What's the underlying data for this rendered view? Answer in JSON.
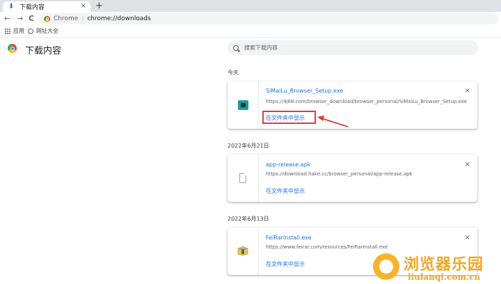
{
  "tab": {
    "title": "下载内容",
    "close": "×",
    "new_tab": "+"
  },
  "toolbar": {
    "back": "←",
    "forward": "→",
    "reload": "C",
    "omnibox_label": "Chrome",
    "omnibox_sep": "|",
    "url": "chrome://downloads"
  },
  "bookmarks": [
    {
      "label": "应用"
    },
    {
      "label": "网址大全"
    }
  ],
  "page": {
    "title": "下载内容",
    "search_placeholder": "搜索下载内容"
  },
  "groups": [
    {
      "date": "今天",
      "item": {
        "name": "SiMaiLu_Browser_Setup.exe",
        "url": "https://4j88.com/browser_download/browser_personal/SiMaiLu_Browser_Setup.exe",
        "action": "在文件夹中显示",
        "remove": "×",
        "icon": "exe-icon"
      }
    },
    {
      "date": "2022年6月21日",
      "item": {
        "name": "app-release.apk",
        "url": "https://download.hake.cc/browser_personal/app-release.apk",
        "action": "在文件夹中显示",
        "remove": "×",
        "icon": "file-icon"
      }
    },
    {
      "date": "2022年6月13日",
      "item": {
        "name": "FeiRarInstall.exe",
        "url": "https://www.feirar.com/resources/FeiRarInstall.exe",
        "action": "在文件夹中显示",
        "remove": "×",
        "icon": "rar-icon"
      }
    }
  ],
  "watermark": {
    "cn": "浏览器乐园",
    "en": "liulanqi.com.cn"
  },
  "colors": {
    "accent": "#1a73e8",
    "highlight": "#e53935",
    "watermark": "#f5a623"
  }
}
